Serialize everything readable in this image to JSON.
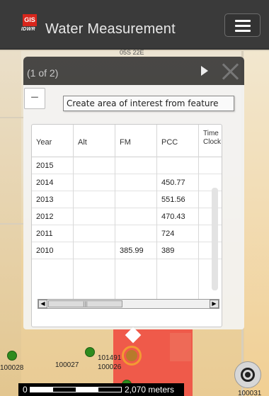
{
  "header": {
    "logo_top": "GIS",
    "logo_bottom": "IDWR",
    "title": "Water Measurement"
  },
  "map": {
    "township_label": "05S 22E",
    "wells": [
      {
        "id": "100028"
      },
      {
        "id": "100027"
      },
      {
        "id": "101491"
      },
      {
        "id": "100026"
      },
      {
        "id": "100031"
      }
    ],
    "scale_zero": "0",
    "scale_distance": "2,070 meters"
  },
  "popup": {
    "count": "(1 of 2)",
    "tooltip": "Create area of interest from feature",
    "zoom_out_label": "−",
    "table": {
      "headers": [
        "Year",
        "Alt",
        "FM",
        "PCC",
        "Time Clock"
      ],
      "rows": [
        {
          "year": "2015",
          "alt": "",
          "fm": "",
          "pcc": "",
          "time": ""
        },
        {
          "year": "2014",
          "alt": "",
          "fm": "",
          "pcc": "450.77",
          "time": ""
        },
        {
          "year": "2013",
          "alt": "",
          "fm": "",
          "pcc": "551.56",
          "time": ""
        },
        {
          "year": "2012",
          "alt": "",
          "fm": "",
          "pcc": "470.43",
          "time": ""
        },
        {
          "year": "2011",
          "alt": "",
          "fm": "",
          "pcc": "724",
          "time": ""
        },
        {
          "year": "2010",
          "alt": "",
          "fm": "385.99",
          "pcc": "389",
          "time": ""
        }
      ]
    }
  },
  "colors": {
    "header_bg": "#3a3a3a",
    "logo_red": "#d8261c",
    "well_green": "#2e8b1e",
    "selected_orange": "#f39a33",
    "parcel_red": "#ef5a4a"
  },
  "icons": {
    "menu": "hamburger-icon",
    "next": "next-arrow-icon",
    "close": "close-icon",
    "locate": "locate-crosshair-icon"
  }
}
